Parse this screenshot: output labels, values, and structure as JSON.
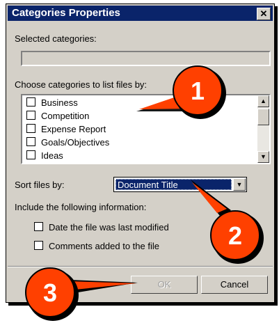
{
  "dialog": {
    "title": "Categories Properties",
    "close_glyph": "✕",
    "selected_label": "Selected categories:",
    "selected_value": "",
    "choose_label": "Choose categories to list files by:",
    "categories": [
      "Business",
      "Competition",
      "Expense Report",
      "Goals/Objectives",
      "Ideas"
    ],
    "sort_label": "Sort files by:",
    "sort_value": "Document Title",
    "include_label": "Include the following information:",
    "options": [
      "Date the file was last modified",
      "Comments added to the file"
    ],
    "ok_label": "OK",
    "cancel_label": "Cancel"
  },
  "callouts": [
    "1",
    "2",
    "3"
  ],
  "colors": {
    "titlebar": "#0a246a",
    "callout_fill": "#ff4000",
    "callout_border": "#000000"
  }
}
